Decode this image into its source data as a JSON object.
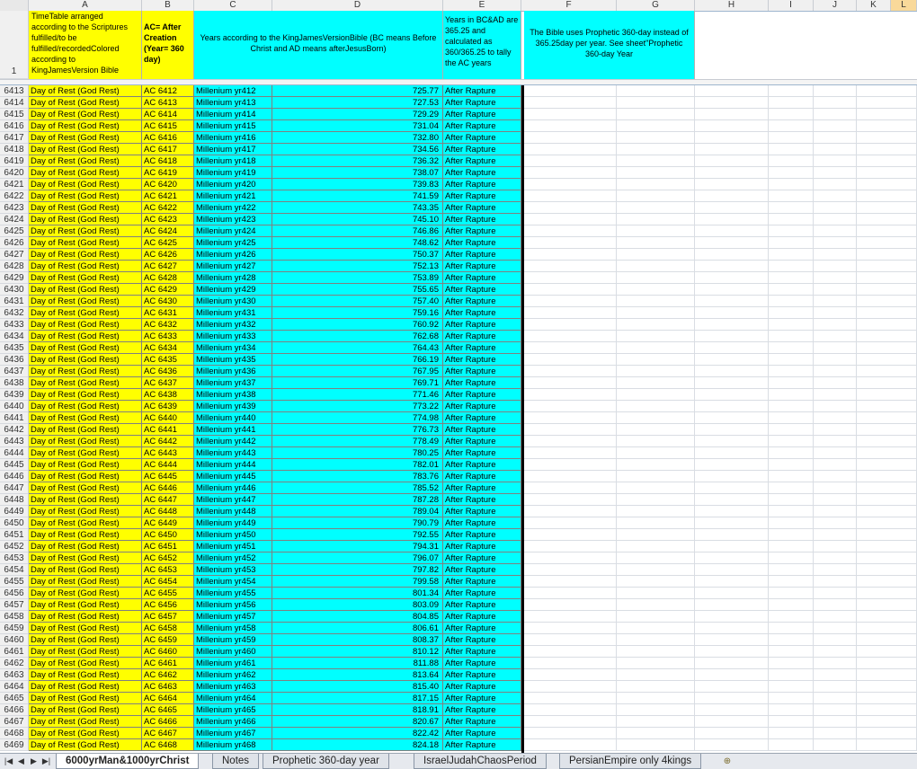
{
  "columns": [
    "A",
    "B",
    "C",
    "D",
    "E",
    "F",
    "G",
    "H",
    "I",
    "J",
    "K",
    "L"
  ],
  "selected_column": "L",
  "header": {
    "row_number": "1",
    "A": "TimeTable arranged according to the Scriptures fulfilled/to be fulfilled/recordedColored according to KingJamesVersion Bible",
    "B": "AC= After Creation (Year= 360 day)",
    "CDE": "Years according to the KingJamesVersionBible (BC means Before Christ and AD means afterJesusBorn)",
    "F": "Years in BC&AD are 365.25 and calculated as 360/365.25 to tally the AC years",
    "GH": "The Bible uses Prophetic 360-day instead of 365.25day per year. See sheet\"Prophetic 360-day Year"
  },
  "rows": [
    {
      "n": "6413",
      "a": "Day of Rest (God Rest)",
      "b": "AC 6412",
      "c": "Millenium yr412",
      "e": "725.77",
      "f": "After Rapture"
    },
    {
      "n": "6414",
      "a": "Day of Rest (God Rest)",
      "b": "AC 6413",
      "c": "Millenium yr413",
      "e": "727.53",
      "f": "After Rapture"
    },
    {
      "n": "6415",
      "a": "Day of Rest (God Rest)",
      "b": "AC 6414",
      "c": "Millenium yr414",
      "e": "729.29",
      "f": "After Rapture"
    },
    {
      "n": "6416",
      "a": "Day of Rest (God Rest)",
      "b": "AC 6415",
      "c": "Millenium yr415",
      "e": "731.04",
      "f": "After Rapture"
    },
    {
      "n": "6417",
      "a": "Day of Rest (God Rest)",
      "b": "AC 6416",
      "c": "Millenium yr416",
      "e": "732.80",
      "f": "After Rapture"
    },
    {
      "n": "6418",
      "a": "Day of Rest (God Rest)",
      "b": "AC 6417",
      "c": "Millenium yr417",
      "e": "734.56",
      "f": "After Rapture"
    },
    {
      "n": "6419",
      "a": "Day of Rest (God Rest)",
      "b": "AC 6418",
      "c": "Millenium yr418",
      "e": "736.32",
      "f": "After Rapture"
    },
    {
      "n": "6420",
      "a": "Day of Rest (God Rest)",
      "b": "AC 6419",
      "c": "Millenium yr419",
      "e": "738.07",
      "f": "After Rapture"
    },
    {
      "n": "6421",
      "a": "Day of Rest (God Rest)",
      "b": "AC 6420",
      "c": "Millenium yr420",
      "e": "739.83",
      "f": "After Rapture"
    },
    {
      "n": "6422",
      "a": "Day of Rest (God Rest)",
      "b": "AC 6421",
      "c": "Millenium yr421",
      "e": "741.59",
      "f": "After Rapture"
    },
    {
      "n": "6423",
      "a": "Day of Rest (God Rest)",
      "b": "AC 6422",
      "c": "Millenium yr422",
      "e": "743.35",
      "f": "After Rapture"
    },
    {
      "n": "6424",
      "a": "Day of Rest (God Rest)",
      "b": "AC 6423",
      "c": "Millenium yr423",
      "e": "745.10",
      "f": "After Rapture"
    },
    {
      "n": "6425",
      "a": "Day of Rest (God Rest)",
      "b": "AC 6424",
      "c": "Millenium yr424",
      "e": "746.86",
      "f": "After Rapture"
    },
    {
      "n": "6426",
      "a": "Day of Rest (God Rest)",
      "b": "AC 6425",
      "c": "Millenium yr425",
      "e": "748.62",
      "f": "After Rapture"
    },
    {
      "n": "6427",
      "a": "Day of Rest (God Rest)",
      "b": "AC 6426",
      "c": "Millenium yr426",
      "e": "750.37",
      "f": "After Rapture"
    },
    {
      "n": "6428",
      "a": "Day of Rest (God Rest)",
      "b": "AC 6427",
      "c": "Millenium yr427",
      "e": "752.13",
      "f": "After Rapture"
    },
    {
      "n": "6429",
      "a": "Day of Rest (God Rest)",
      "b": "AC 6428",
      "c": "Millenium yr428",
      "e": "753.89",
      "f": "After Rapture"
    },
    {
      "n": "6430",
      "a": "Day of Rest (God Rest)",
      "b": "AC 6429",
      "c": "Millenium yr429",
      "e": "755.65",
      "f": "After Rapture"
    },
    {
      "n": "6431",
      "a": "Day of Rest (God Rest)",
      "b": "AC 6430",
      "c": "Millenium yr430",
      "e": "757.40",
      "f": "After Rapture"
    },
    {
      "n": "6432",
      "a": "Day of Rest (God Rest)",
      "b": "AC 6431",
      "c": "Millenium yr431",
      "e": "759.16",
      "f": "After Rapture"
    },
    {
      "n": "6433",
      "a": "Day of Rest (God Rest)",
      "b": "AC 6432",
      "c": "Millenium yr432",
      "e": "760.92",
      "f": "After Rapture"
    },
    {
      "n": "6434",
      "a": "Day of Rest (God Rest)",
      "b": "AC 6433",
      "c": "Millenium yr433",
      "e": "762.68",
      "f": "After Rapture"
    },
    {
      "n": "6435",
      "a": "Day of Rest (God Rest)",
      "b": "AC 6434",
      "c": "Millenium yr434",
      "e": "764.43",
      "f": "After Rapture"
    },
    {
      "n": "6436",
      "a": "Day of Rest (God Rest)",
      "b": "AC 6435",
      "c": "Millenium yr435",
      "e": "766.19",
      "f": "After Rapture"
    },
    {
      "n": "6437",
      "a": "Day of Rest (God Rest)",
      "b": "AC 6436",
      "c": "Millenium yr436",
      "e": "767.95",
      "f": "After Rapture"
    },
    {
      "n": "6438",
      "a": "Day of Rest (God Rest)",
      "b": "AC 6437",
      "c": "Millenium yr437",
      "e": "769.71",
      "f": "After Rapture"
    },
    {
      "n": "6439",
      "a": "Day of Rest (God Rest)",
      "b": "AC 6438",
      "c": "Millenium yr438",
      "e": "771.46",
      "f": "After Rapture"
    },
    {
      "n": "6440",
      "a": "Day of Rest (God Rest)",
      "b": "AC 6439",
      "c": "Millenium yr439",
      "e": "773.22",
      "f": "After Rapture"
    },
    {
      "n": "6441",
      "a": "Day of Rest (God Rest)",
      "b": "AC 6440",
      "c": "Millenium yr440",
      "e": "774.98",
      "f": "After Rapture"
    },
    {
      "n": "6442",
      "a": "Day of Rest (God Rest)",
      "b": "AC 6441",
      "c": "Millenium yr441",
      "e": "776.73",
      "f": "After Rapture"
    },
    {
      "n": "6443",
      "a": "Day of Rest (God Rest)",
      "b": "AC 6442",
      "c": "Millenium yr442",
      "e": "778.49",
      "f": "After Rapture"
    },
    {
      "n": "6444",
      "a": "Day of Rest (God Rest)",
      "b": "AC 6443",
      "c": "Millenium yr443",
      "e": "780.25",
      "f": "After Rapture"
    },
    {
      "n": "6445",
      "a": "Day of Rest (God Rest)",
      "b": "AC 6444",
      "c": "Millenium yr444",
      "e": "782.01",
      "f": "After Rapture"
    },
    {
      "n": "6446",
      "a": "Day of Rest (God Rest)",
      "b": "AC 6445",
      "c": "Millenium yr445",
      "e": "783.76",
      "f": "After Rapture"
    },
    {
      "n": "6447",
      "a": "Day of Rest (God Rest)",
      "b": "AC 6446",
      "c": "Millenium yr446",
      "e": "785.52",
      "f": "After Rapture"
    },
    {
      "n": "6448",
      "a": "Day of Rest (God Rest)",
      "b": "AC 6447",
      "c": "Millenium yr447",
      "e": "787.28",
      "f": "After Rapture"
    },
    {
      "n": "6449",
      "a": "Day of Rest (God Rest)",
      "b": "AC 6448",
      "c": "Millenium yr448",
      "e": "789.04",
      "f": "After Rapture"
    },
    {
      "n": "6450",
      "a": "Day of Rest (God Rest)",
      "b": "AC 6449",
      "c": "Millenium yr449",
      "e": "790.79",
      "f": "After Rapture"
    },
    {
      "n": "6451",
      "a": "Day of Rest (God Rest)",
      "b": "AC 6450",
      "c": "Millenium yr450",
      "e": "792.55",
      "f": "After Rapture"
    },
    {
      "n": "6452",
      "a": "Day of Rest (God Rest)",
      "b": "AC 6451",
      "c": "Millenium yr451",
      "e": "794.31",
      "f": "After Rapture"
    },
    {
      "n": "6453",
      "a": "Day of Rest (God Rest)",
      "b": "AC 6452",
      "c": "Millenium yr452",
      "e": "796.07",
      "f": "After Rapture"
    },
    {
      "n": "6454",
      "a": "Day of Rest (God Rest)",
      "b": "AC 6453",
      "c": "Millenium yr453",
      "e": "797.82",
      "f": "After Rapture"
    },
    {
      "n": "6455",
      "a": "Day of Rest (God Rest)",
      "b": "AC 6454",
      "c": "Millenium yr454",
      "e": "799.58",
      "f": "After Rapture"
    },
    {
      "n": "6456",
      "a": "Day of Rest (God Rest)",
      "b": "AC 6455",
      "c": "Millenium yr455",
      "e": "801.34",
      "f": "After Rapture"
    },
    {
      "n": "6457",
      "a": "Day of Rest (God Rest)",
      "b": "AC 6456",
      "c": "Millenium yr456",
      "e": "803.09",
      "f": "After Rapture"
    },
    {
      "n": "6458",
      "a": "Day of Rest (God Rest)",
      "b": "AC 6457",
      "c": "Millenium yr457",
      "e": "804.85",
      "f": "After Rapture"
    },
    {
      "n": "6459",
      "a": "Day of Rest (God Rest)",
      "b": "AC 6458",
      "c": "Millenium yr458",
      "e": "806.61",
      "f": "After Rapture"
    },
    {
      "n": "6460",
      "a": "Day of Rest (God Rest)",
      "b": "AC 6459",
      "c": "Millenium yr459",
      "e": "808.37",
      "f": "After Rapture"
    },
    {
      "n": "6461",
      "a": "Day of Rest (God Rest)",
      "b": "AC 6460",
      "c": "Millenium yr460",
      "e": "810.12",
      "f": "After Rapture"
    },
    {
      "n": "6462",
      "a": "Day of Rest (God Rest)",
      "b": "AC 6461",
      "c": "Millenium yr461",
      "e": "811.88",
      "f": "After Rapture"
    },
    {
      "n": "6463",
      "a": "Day of Rest (God Rest)",
      "b": "AC 6462",
      "c": "Millenium yr462",
      "e": "813.64",
      "f": "After Rapture"
    },
    {
      "n": "6464",
      "a": "Day of Rest (God Rest)",
      "b": "AC 6463",
      "c": "Millenium yr463",
      "e": "815.40",
      "f": "After Rapture"
    },
    {
      "n": "6465",
      "a": "Day of Rest (God Rest)",
      "b": "AC 6464",
      "c": "Millenium yr464",
      "e": "817.15",
      "f": "After Rapture"
    },
    {
      "n": "6466",
      "a": "Day of Rest (God Rest)",
      "b": "AC 6465",
      "c": "Millenium yr465",
      "e": "818.91",
      "f": "After Rapture"
    },
    {
      "n": "6467",
      "a": "Day of Rest (God Rest)",
      "b": "AC 6466",
      "c": "Millenium yr466",
      "e": "820.67",
      "f": "After Rapture"
    },
    {
      "n": "6468",
      "a": "Day of Rest (God Rest)",
      "b": "AC 6467",
      "c": "Millenium yr467",
      "e": "822.42",
      "f": "After Rapture"
    },
    {
      "n": "6469",
      "a": "Day of Rest (God Rest)",
      "b": "AC 6468",
      "c": "Millenium yr468",
      "e": "824.18",
      "f": "After Rapture"
    }
  ],
  "sheet_tabs": [
    "6000yrMan&1000yrChrist",
    "Notes",
    "Prophetic 360-day year",
    "IsraelJudahChaosPeriod",
    "PersianEmpire only 4kings"
  ],
  "active_tab": "6000yrMan&1000yrChrist",
  "colors": {
    "cyan": "#00ffff",
    "yellow": "#ffff00",
    "selected_header": "#f9d99a"
  }
}
